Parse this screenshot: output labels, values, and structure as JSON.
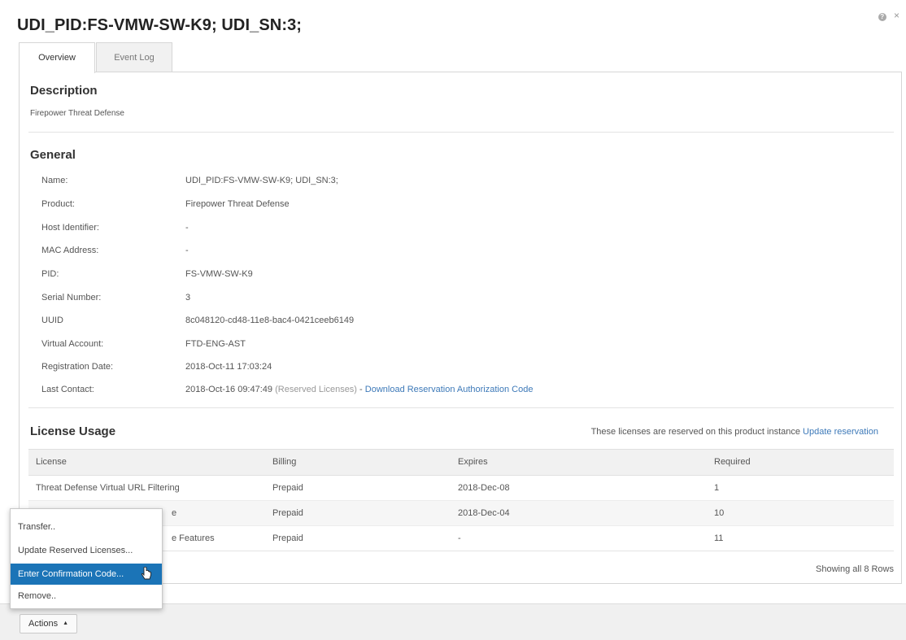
{
  "title": "UDI_PID:FS-VMW-SW-K9; UDI_SN:3;",
  "top_icons": {
    "help": "?",
    "close": "×"
  },
  "tabs": [
    {
      "label": "Overview",
      "active": true
    },
    {
      "label": "Event Log",
      "active": false
    }
  ],
  "description": {
    "heading": "Description",
    "text": "Firepower Threat Defense"
  },
  "general": {
    "heading": "General",
    "rows": [
      {
        "label": "Name:",
        "value": "UDI_PID:FS-VMW-SW-K9; UDI_SN:3;"
      },
      {
        "label": "Product:",
        "value": "Firepower Threat Defense"
      },
      {
        "label": "Host Identifier:",
        "value": "-"
      },
      {
        "label": "MAC Address:",
        "value": "-"
      },
      {
        "label": "PID:",
        "value": "FS-VMW-SW-K9"
      },
      {
        "label": "Serial Number:",
        "value": "3"
      },
      {
        "label": "UUID",
        "value": "8c048120-cd48-11e8-bac4-0421ceeb6149"
      },
      {
        "label": "Virtual Account:",
        "value": "FTD-ENG-AST"
      },
      {
        "label": "Registration Date:",
        "value": "2018-Oct-11 17:03:24"
      },
      {
        "label": "Last Contact:",
        "value": "2018-Oct-16 09:47:49"
      }
    ],
    "last_contact_note": "(Reserved Licenses)",
    "last_contact_sep": "-",
    "last_contact_link": "Download Reservation Authorization Code"
  },
  "license_usage": {
    "heading": "License Usage",
    "note": "These licenses are reserved on this product instance",
    "note_link": "Update reservation",
    "columns": [
      "License",
      "Billing",
      "Expires",
      "Required"
    ],
    "rows": [
      {
        "license": "Threat Defense Virtual URL Filtering",
        "billing": "Prepaid",
        "expires": "2018-Dec-08",
        "required": "1"
      },
      {
        "license": "e",
        "billing": "Prepaid",
        "expires": "2018-Dec-04",
        "required": "10"
      },
      {
        "license": "e Features",
        "billing": "Prepaid",
        "expires": "-",
        "required": "11"
      }
    ],
    "showing": "Showing all 8 Rows"
  },
  "actions_menu": {
    "items": [
      {
        "label": "Transfer..",
        "selected": false
      },
      {
        "label": "Update Reserved Licenses...",
        "selected": false
      },
      {
        "label": "Enter Confirmation Code...",
        "selected": true
      },
      {
        "label": "Remove..",
        "selected": false
      }
    ]
  },
  "footer": {
    "actions_label": "Actions",
    "actions_caret": "▲"
  },
  "colors": {
    "link": "#3d79b8",
    "menu_selected": "#1b74b7"
  }
}
